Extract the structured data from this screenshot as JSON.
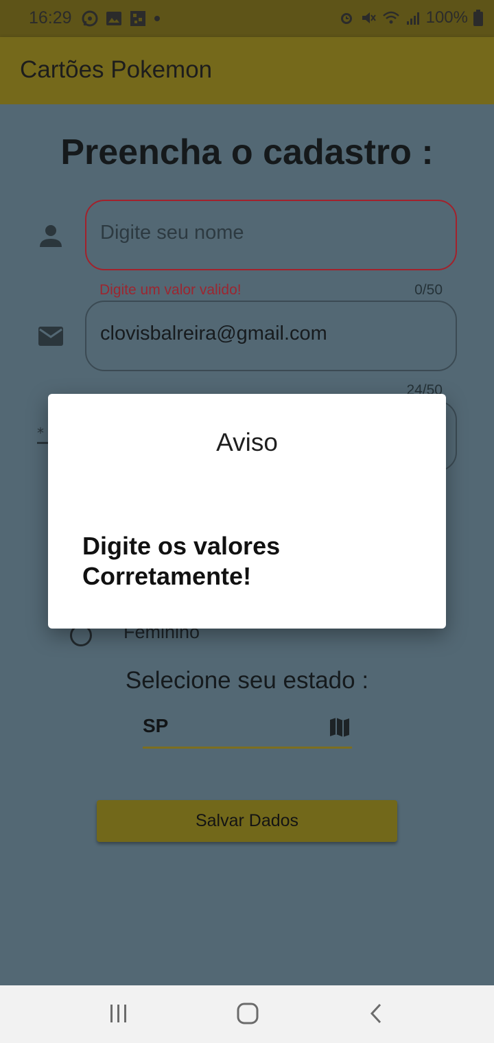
{
  "status_bar": {
    "time": "16:29",
    "battery": "100%",
    "icons_left": [
      "whatsapp-icon",
      "gallery-icon",
      "sim-icon",
      "dot-icon"
    ],
    "icons_right": [
      "alarm-icon",
      "mute-icon",
      "wifi-icon",
      "signal-icon",
      "battery-icon"
    ]
  },
  "app_bar": {
    "title": "Cartões Pokemon"
  },
  "form": {
    "title": "Preencha o cadastro :",
    "name_field": {
      "placeholder": "Digite seu nome",
      "error": "Digite um valor valido!",
      "counter": "0/50"
    },
    "email_field": {
      "value": "clovisbalreira@gmail.com",
      "counter": "24/50"
    },
    "gender_option": {
      "label": "Feminino"
    },
    "state_label": "Selecione seu estado :",
    "state_value": "SP",
    "save_button": "Salvar Dados"
  },
  "dialog": {
    "title": "Aviso",
    "message": "Digite os valores Corretamente!"
  },
  "colors": {
    "status_bar": "#5e5418",
    "app_bar": "#75691b",
    "background_scrim": "#536874",
    "error": "#a3212b",
    "accent": "#72681a"
  },
  "nav_bar": {
    "icons": [
      "recents-icon",
      "home-icon",
      "back-icon"
    ]
  }
}
